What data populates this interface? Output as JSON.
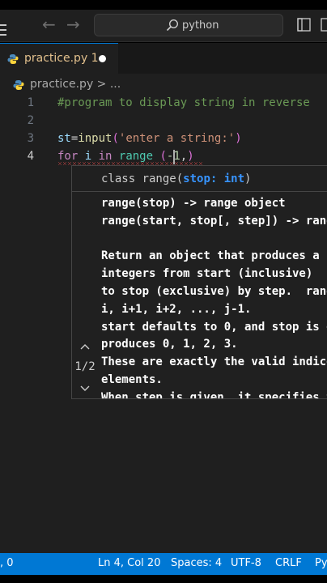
{
  "titlebar": {
    "search_text": "python",
    "back_arrow": "←",
    "forward_arrow": "→"
  },
  "tab": {
    "filename": "practice.py 1",
    "unsaved_dot": "modified-dot"
  },
  "breadcrumb": {
    "text": "practice.py > ..."
  },
  "editor": {
    "line_numbers": [
      "1",
      "2",
      "3",
      "4"
    ],
    "line1_comment": "#program to display string in reverse",
    "line3": {
      "var": "st",
      "eq": "=",
      "fn": "input",
      "open": "(",
      "str": "'enter a string:'",
      "close": ")"
    },
    "line4": {
      "kw_for": "for",
      "var": " i ",
      "kw_in": "in",
      "sp": " ",
      "fn": "range",
      "sp2": " ",
      "open": "(",
      "num": "-1",
      "comma": ",",
      "close": ")"
    }
  },
  "hover": {
    "sig_prefix": "class ",
    "sig_name": "range",
    "sig_open": "(",
    "sig_param": "stop: int",
    "sig_close": ")",
    "body": "range(stop) -> range object\nrange(start, stop[, step]) -> range object\n\nReturn an object that produces a sequence of\nintegers from start (inclusive)\nto stop (exclusive) by step.  range(i, j) produces\ni, i+1, i+2, ..., j-1.\nstart defaults to 0, and stop is omitted!\nproduces 0, 1, 2, 3.\nThese are exactly the valid indices for a list of 4\nelements.\nWhen step is given, it specifies the increment",
    "pager": "1/2"
  },
  "statusbar": {
    "left": ", 0",
    "position": "Ln 4, Col 20",
    "spaces": "Spaces: 4",
    "encoding": "UTF-8",
    "eol": "CRLF",
    "language": "Py"
  },
  "colors": {
    "accent": "#0078d4",
    "editor_bg": "#1f1f1f",
    "error": "#f14c4c"
  }
}
